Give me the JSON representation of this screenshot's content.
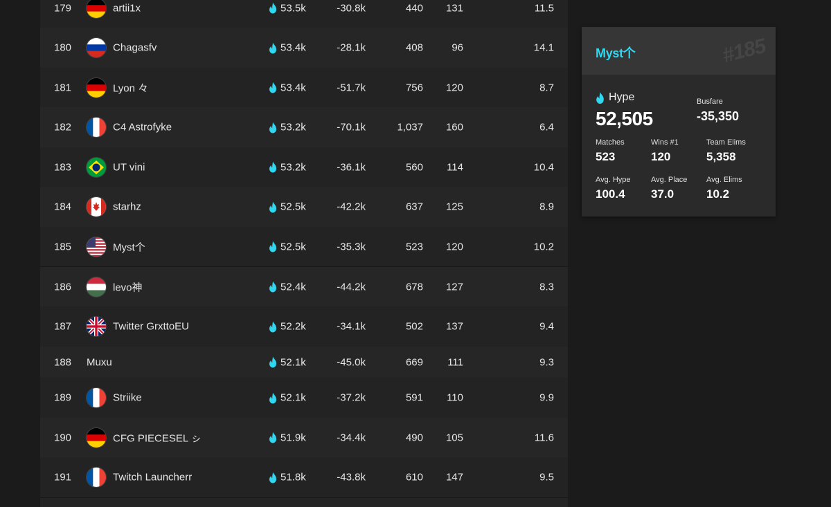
{
  "colors": {
    "accent": "#2fd7f0",
    "flame": "#2fd7f0"
  },
  "rows": [
    {
      "rank": "179",
      "flag": "de",
      "name": "artii1x",
      "hype": "53.5k",
      "busfare": "-30.8k",
      "matches": "440",
      "wins": "131",
      "avg": "11.5"
    },
    {
      "rank": "180",
      "flag": "ru",
      "name": "Chagasfv",
      "hype": "53.4k",
      "busfare": "-28.1k",
      "matches": "408",
      "wins": "96",
      "avg": "14.1"
    },
    {
      "rank": "181",
      "flag": "de",
      "name": "Lyon 々",
      "hype": "53.4k",
      "busfare": "-51.7k",
      "matches": "756",
      "wins": "120",
      "avg": "8.7"
    },
    {
      "rank": "182",
      "flag": "fr",
      "name": "C4 Astrofyke",
      "hype": "53.2k",
      "busfare": "-70.1k",
      "matches": "1,037",
      "wins": "160",
      "avg": "6.4"
    },
    {
      "rank": "183",
      "flag": "br",
      "name": "UT vini",
      "hype": "53.2k",
      "busfare": "-36.1k",
      "matches": "560",
      "wins": "114",
      "avg": "10.4"
    },
    {
      "rank": "184",
      "flag": "ca",
      "name": "starhz",
      "hype": "52.5k",
      "busfare": "-42.2k",
      "matches": "637",
      "wins": "125",
      "avg": "8.9"
    },
    {
      "rank": "185",
      "flag": "us",
      "name": "Myst个",
      "hype": "52.5k",
      "busfare": "-35.3k",
      "matches": "523",
      "wins": "120",
      "avg": "10.2"
    },
    {
      "rank": "186",
      "flag": "hu",
      "name": "levo神",
      "hype": "52.4k",
      "busfare": "-44.2k",
      "matches": "678",
      "wins": "127",
      "avg": "8.3"
    },
    {
      "rank": "187",
      "flag": "gb",
      "name": "Twitter GrxttoEU",
      "hype": "52.2k",
      "busfare": "-34.1k",
      "matches": "502",
      "wins": "137",
      "avg": "9.4"
    },
    {
      "rank": "188",
      "flag": "",
      "name": "Muxu",
      "hype": "52.1k",
      "busfare": "-45.0k",
      "matches": "669",
      "wins": "111",
      "avg": "9.3"
    },
    {
      "rank": "189",
      "flag": "fr",
      "name": "Striike",
      "hype": "52.1k",
      "busfare": "-37.2k",
      "matches": "591",
      "wins": "110",
      "avg": "9.9"
    },
    {
      "rank": "190",
      "flag": "de",
      "name": "CFG PIECESEL ㇱ",
      "hype": "51.9k",
      "busfare": "-34.4k",
      "matches": "490",
      "wins": "105",
      "avg": "11.6"
    },
    {
      "rank": "191",
      "flag": "fr",
      "name": "Twitch Launcherr",
      "hype": "51.8k",
      "busfare": "-43.8k",
      "matches": "610",
      "wins": "147",
      "avg": "9.5"
    }
  ],
  "card": {
    "name": "Myst个",
    "rank": "#185",
    "hype_label": "Hype",
    "hype_value": "52,505",
    "busfare_label": "Busfare",
    "busfare_value": "-35,350",
    "matches_label": "Matches",
    "matches_value": "523",
    "wins_label": "Wins #1",
    "wins_value": "120",
    "team_elims_label": "Team Elims",
    "team_elims_value": "5,358",
    "avg_hype_label": "Avg. Hype",
    "avg_hype_value": "100.4",
    "avg_place_label": "Avg. Place",
    "avg_place_value": "37.0",
    "avg_elims_label": "Avg. Elims",
    "avg_elims_value": "10.2"
  }
}
